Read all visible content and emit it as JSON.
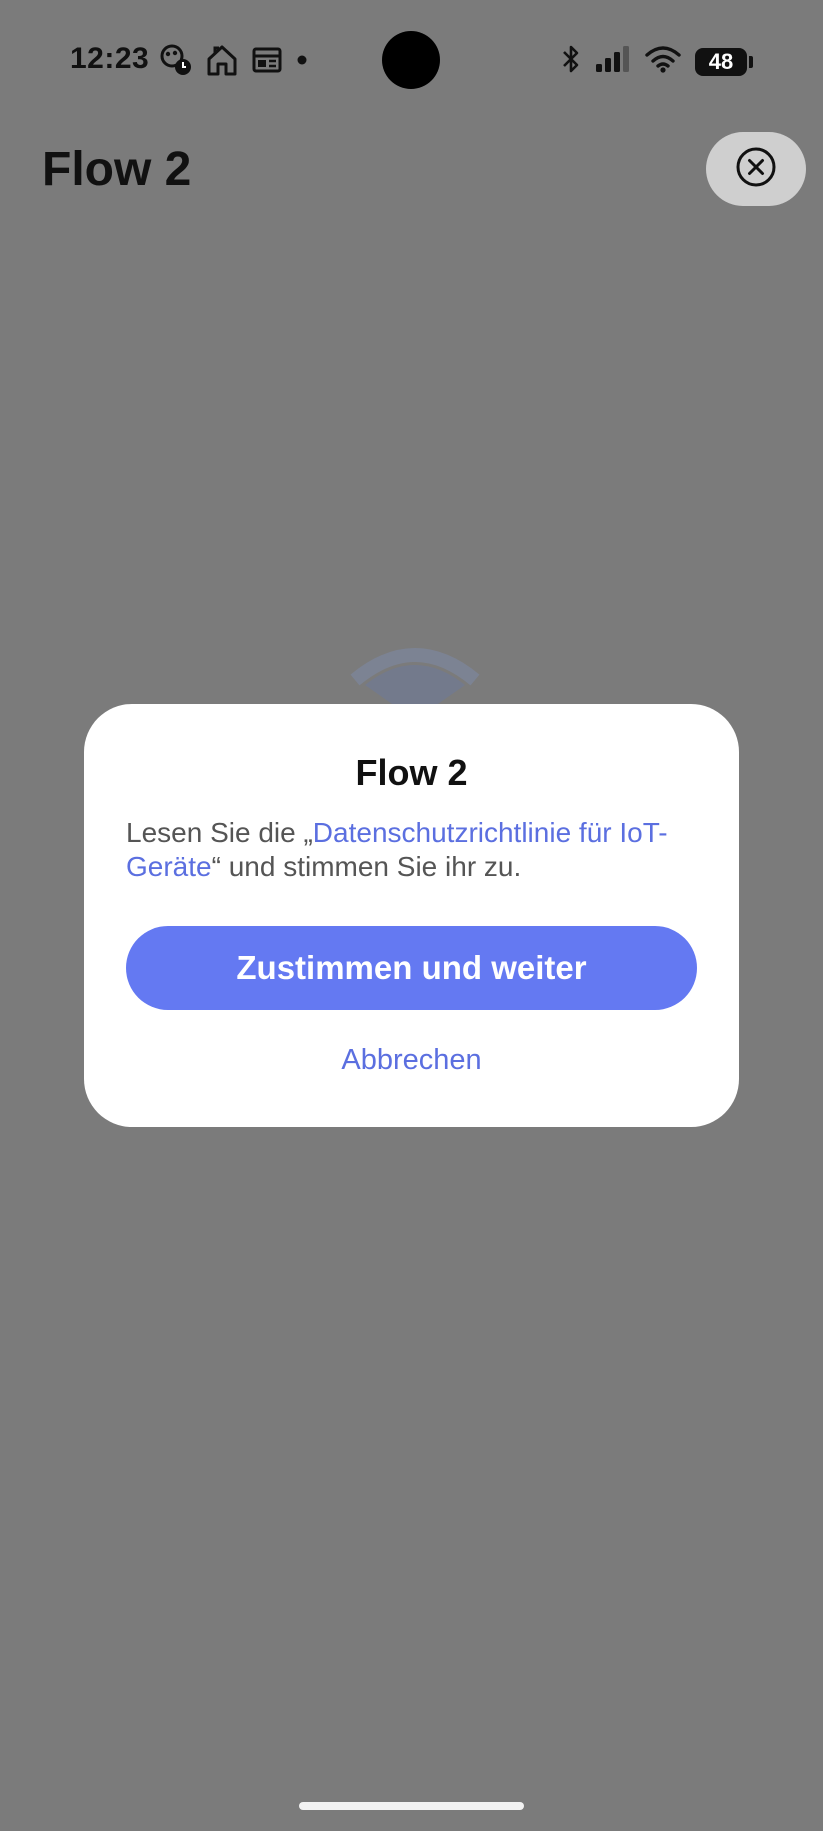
{
  "status_bar": {
    "time": "12:23",
    "battery_level": "48",
    "left_icons": [
      "activity-alarm-icon",
      "home-icon",
      "news-icon",
      "dot-icon"
    ],
    "right_icons": [
      "bluetooth-icon",
      "signal-icon",
      "wifi-icon",
      "battery-icon"
    ]
  },
  "header": {
    "title": "Flow 2",
    "close_icon": "close-circle-icon"
  },
  "dialog": {
    "title": "Flow 2",
    "body_prefix": "Lesen Sie die „",
    "policy_link": "Datenschutzrichtlinie für IoT-Geräte",
    "body_suffix": "“ und stimmen Sie ihr zu.",
    "agree_label": "Zustimmen und weiter",
    "cancel_label": "Abbrechen"
  },
  "colors": {
    "accent": "#6479f2",
    "link": "#5b6fe0",
    "scrim": "#7b7b7b",
    "dialog_bg": "#ffffff"
  }
}
